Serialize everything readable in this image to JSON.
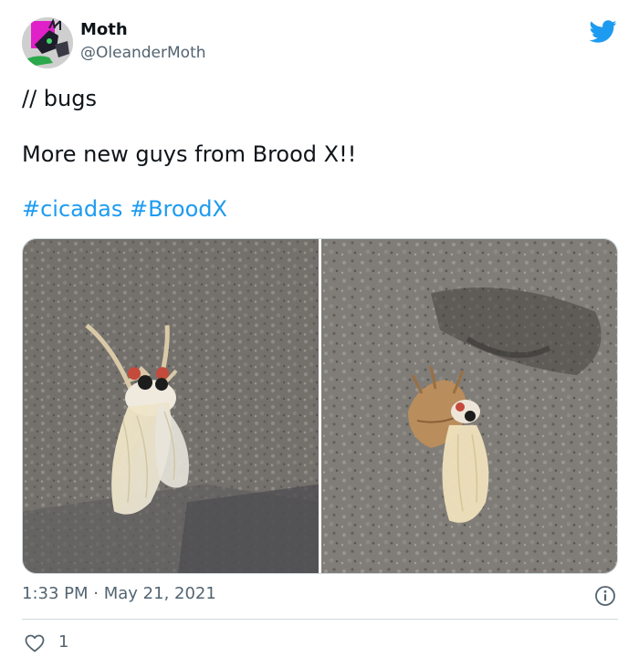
{
  "author": {
    "name": "Moth",
    "handle": "@OleanderMoth"
  },
  "tweet": {
    "lines": [
      "// bugs",
      "More new guys from Brood X!!"
    ],
    "hashtags": [
      "#cicadas",
      "#BroodX"
    ]
  },
  "media": {
    "photos": [
      "cicada-on-rock",
      "cicada-emerging-from-shell"
    ]
  },
  "timestamp": {
    "time": "1:33 PM",
    "separator": "·",
    "date": "May 21, 2021"
  },
  "actions": {
    "like_count": "1"
  },
  "icons": {
    "brand": "twitter-bird-icon",
    "info": "info-icon",
    "like": "heart-icon"
  },
  "colors": {
    "link": "#1d9bf0",
    "secondary_text": "#536471",
    "text": "#0f1419",
    "border": "#cfd9de"
  }
}
